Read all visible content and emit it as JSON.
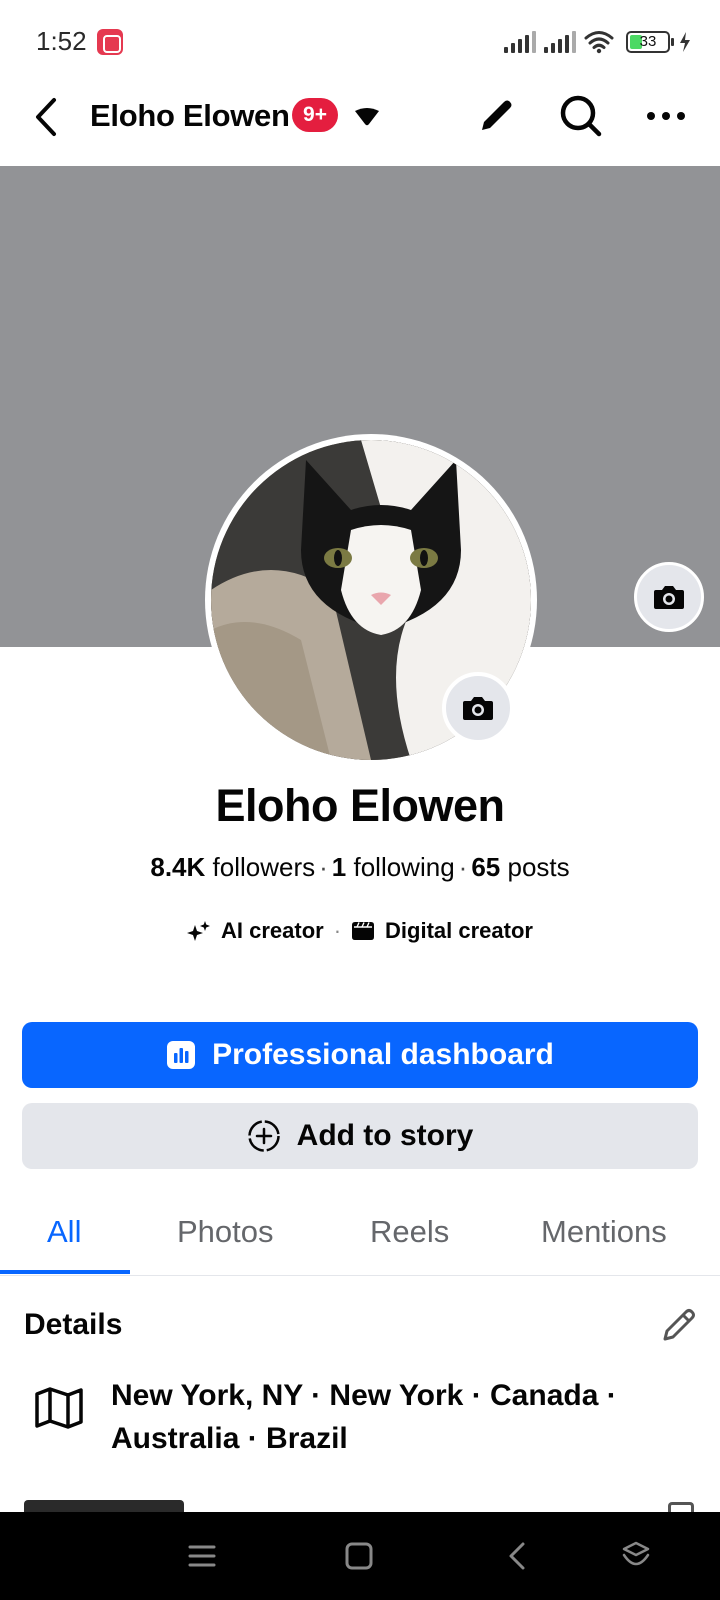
{
  "status_bar": {
    "time": "1:52",
    "battery_level": "33",
    "battery_percent": 33,
    "app_icon": "screen-recorder-icon"
  },
  "header": {
    "title": "Eloho Elowen",
    "badge": "9+",
    "icons": [
      "back-arrow-icon",
      "caret-down-icon",
      "pencil-icon",
      "search-icon",
      "more-dots-icon"
    ]
  },
  "profile": {
    "name": "Eloho Elowen",
    "stats": {
      "followers_count": "8.4K",
      "followers_label": "followers",
      "following_count": "1",
      "following_label": "following",
      "posts_count": "65",
      "posts_label": "posts",
      "separator": "·"
    },
    "tags": [
      {
        "label": "AI creator",
        "icon": "sparkles-icon"
      },
      {
        "label": "Digital creator",
        "icon": "clapperboard-icon"
      }
    ]
  },
  "actions": {
    "primary_label": "Professional dashboard",
    "secondary_label": "Add to story"
  },
  "tabs": [
    "All",
    "Photos",
    "Reels",
    "Mentions"
  ],
  "active_tab": "All",
  "details": {
    "title": "Details",
    "location_line1": "New York, NY · New York · Canada ·",
    "location_line2": "Australia · Brazil"
  },
  "colors": {
    "accent": "#0866ff",
    "badge": "#e41e3f",
    "cover": "#929396",
    "secondary_button": "#e4e6eb"
  }
}
